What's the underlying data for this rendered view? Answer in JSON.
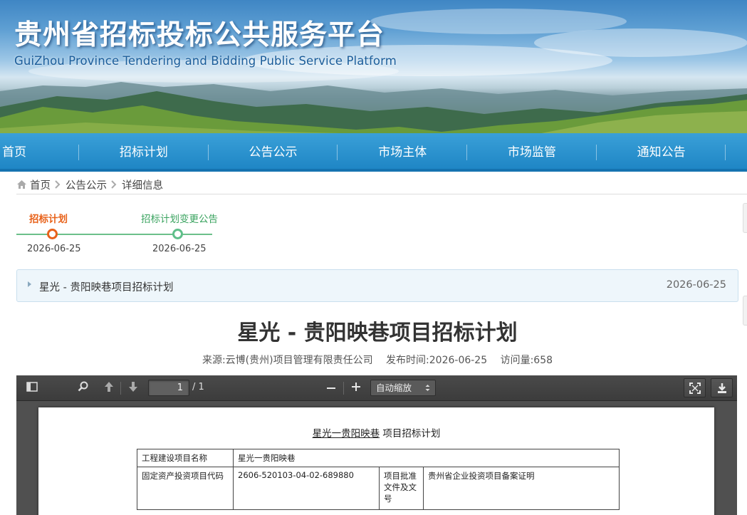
{
  "header": {
    "title_cn": "贵州省招标投标公共服务平台",
    "title_en": "GuiZhou Province Tendering and Bidding Public Service Platform"
  },
  "nav": {
    "items": [
      {
        "label": "首页"
      },
      {
        "label": "招标计划"
      },
      {
        "label": "公告公示"
      },
      {
        "label": "市场主体"
      },
      {
        "label": "市场监管"
      },
      {
        "label": "通知公告"
      }
    ]
  },
  "breadcrumb": {
    "items": [
      "首页",
      "公告公示",
      "详细信息"
    ]
  },
  "timeline": {
    "steps": [
      {
        "label": "招标计划",
        "date": "2026-06-25"
      },
      {
        "label": "招标计划变更公告",
        "date": "2026-06-25"
      }
    ]
  },
  "project_bar": {
    "name": "星光 - 贵阳映巷项目招标计划",
    "date": "2026-06-25"
  },
  "article": {
    "title": "星光 - 贵阳映巷项目招标计划",
    "source": "来源:云博(贵州)项目管理有限责任公司",
    "publish_time": "发布时间:2026-06-25",
    "visits": "访问量:658"
  },
  "pdf_viewer": {
    "page_number": "1",
    "page_total": "/ 1",
    "zoom": "自动缩放",
    "document": {
      "title_underlined": "星光一贵阳映巷",
      "title_rest": " 项目招标计划",
      "rows": [
        {
          "label": "工程建设项目名称",
          "value": "星光一贵阳映巷"
        },
        {
          "label": "固定资产投资项目代码",
          "value": "2606-520103-04-02-689880",
          "label2": "项目批准文件及文号",
          "value2": "贵州省企业投资项目备案证明"
        }
      ]
    }
  }
}
